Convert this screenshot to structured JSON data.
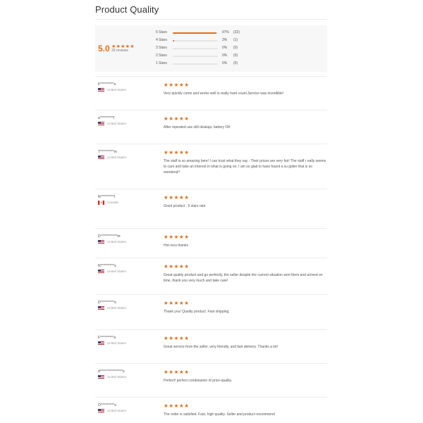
{
  "page_title": "Product Quality",
  "summary": {
    "average": "5.0",
    "stars": "★★★★★",
    "review_count": "33 reviews",
    "rating_value": 5,
    "accent_color": "#e0701c",
    "histogram": [
      {
        "label": "5 Stars",
        "percent": "97%",
        "count": "(32)",
        "fraction": 0.97
      },
      {
        "label": "4 Stars",
        "percent": "3%",
        "count": "(1)",
        "fraction": 0.03
      },
      {
        "label": "3 Stars",
        "percent": "0%",
        "count": "(0)",
        "fraction": 0
      },
      {
        "label": "2 Stars",
        "percent": "0%",
        "count": "(0)",
        "fraction": 0
      },
      {
        "label": "1 Stars",
        "percent": "0%",
        "count": "(0)",
        "fraction": 0
      }
    ]
  },
  "reviews": [
    {
      "name": "F*********s",
      "country": "United States",
      "flag": "us-flag-icon",
      "rating": 5,
      "stars": "★★★★★",
      "text": "Very quickly come and works well is really hard count.Service was incredible!"
    },
    {
      "name": "a*********l",
      "country": "United States",
      "flag": "us-flag-icon",
      "rating": 5,
      "stars": "★★★★★",
      "text": "After repeated use still dzialaja, battery OK"
    },
    {
      "name": "T*********m",
      "country": "United States",
      "flag": "us-flag-icon",
      "rating": 5,
      "stars": "★★★★★",
      "text": "The staff is so amazing here! I can trust what they say . Their prices are very fair! The staff r eally seems to care and take an interest in what is going on. I am so glad to have found a su pplier that is so wonderul!!"
    },
    {
      "name": "N*********l",
      "country": "Canada",
      "flag": "ca-flag-icon",
      "rating": 5,
      "stars": "★★★★★",
      "text": "Good product , 5 stars rate"
    },
    {
      "name": "D***********m",
      "country": "United States",
      "flag": "us-flag-icon",
      "rating": 5,
      "stars": "★★★★★",
      "text": "Hot recu thanks"
    },
    {
      "name": "N*********s",
      "country": "United States",
      "flag": "us-flag-icon",
      "rating": 5,
      "stars": "★★★★★",
      "text": "Great quality product and go perfectly, the seller despite the current situation sent them and arrived on time, thank you very much and take care!"
    },
    {
      "name": "D*********o",
      "country": "United States",
      "flag": "us-flag-icon",
      "rating": 5,
      "stars": "★★★★★",
      "text": "Thank you! Quality product. Fast shipping."
    },
    {
      "name": "F*********e",
      "country": "United States",
      "flag": "us-flag-icon",
      "rating": 5,
      "stars": "★★★★★",
      "text": "Great service from the seller, very friendly, and fast delivery. Thanks a lot!"
    },
    {
      "name": "d***************s",
      "country": "United States",
      "flag": "us-flag-icon",
      "rating": 5,
      "stars": "★★★★★",
      "text": "Perfect! perfect combination of price-quality."
    },
    {
      "name": "O*********s",
      "country": "United States",
      "flag": "us-flag-icon",
      "rating": 5,
      "stars": "★★★★★",
      "text": "The order is satisfied. Fast, high quality. Seller and product recommend"
    }
  ]
}
